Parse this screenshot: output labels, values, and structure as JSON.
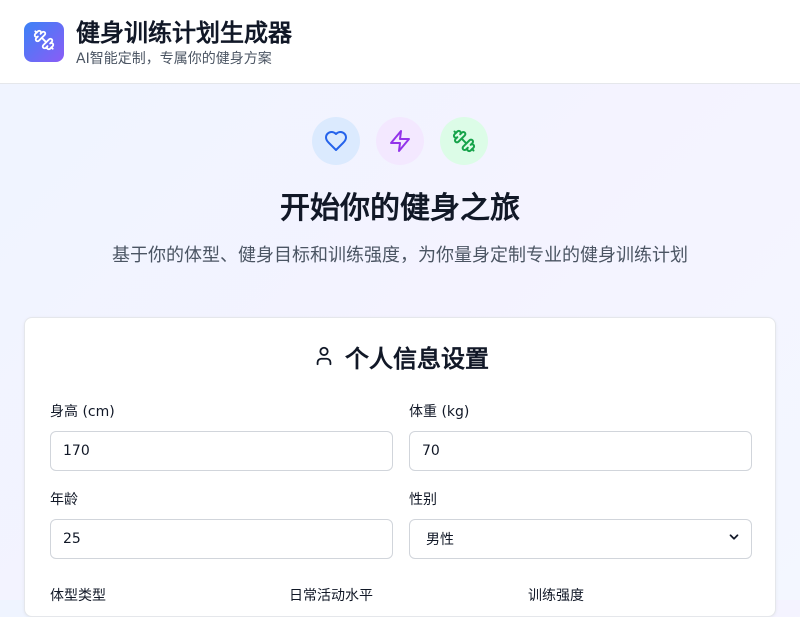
{
  "header": {
    "title": "健身训练计划生成器",
    "subtitle": "AI智能定制，专属你的健身方案",
    "logo_icon": "dumbbell-icon"
  },
  "hero": {
    "icons": [
      "heart-icon",
      "lightning-icon",
      "dumbbell-icon"
    ],
    "title": "开始你的健身之旅",
    "subtitle": "基于你的体型、健身目标和训练强度，为你量身定制专业的健身训练计划"
  },
  "form": {
    "title": "个人信息设置",
    "title_icon": "user-icon",
    "height_label": "身高 (cm)",
    "height_value": "170",
    "weight_label": "体重 (kg)",
    "weight_value": "70",
    "age_label": "年龄",
    "age_value": "25",
    "gender_label": "性别",
    "gender_value": "男性",
    "body_type_label": "体型类型",
    "activity_label": "日常活动水平",
    "intensity_label": "训练强度"
  },
  "colors": {
    "logo_gradient_start": "#3b82f6",
    "logo_gradient_end": "#8b5cf6",
    "heart": "#2563eb",
    "lightning": "#9333ea",
    "dumbbell": "#16a34a"
  }
}
